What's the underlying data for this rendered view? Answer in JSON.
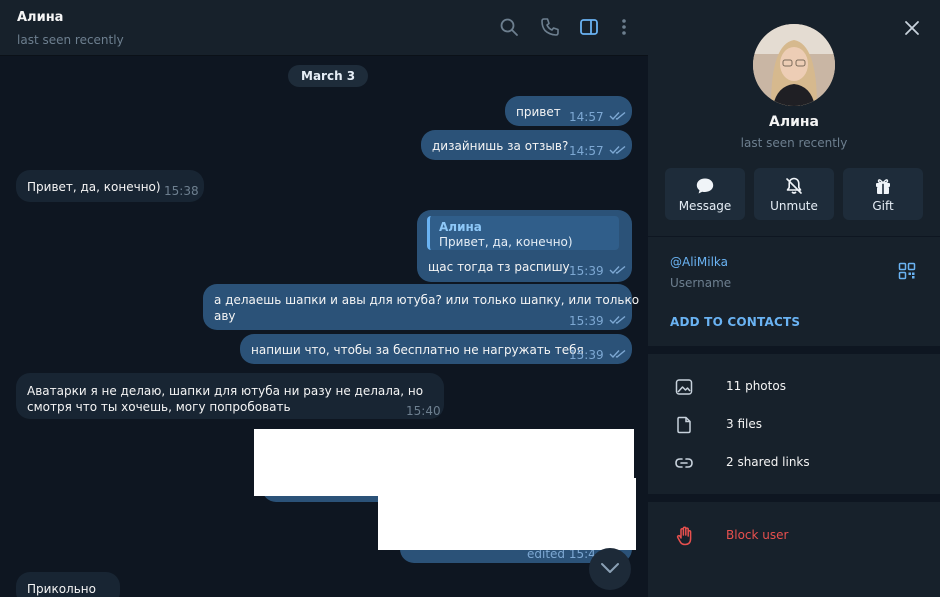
{
  "header": {
    "contact_name": "Алина",
    "status": "last seen recently",
    "icons": [
      "search-icon",
      "phone-icon",
      "sidebar-toggle-icon",
      "more-vertical-icon"
    ]
  },
  "chat": {
    "date_label": "March 3",
    "messages": [
      {
        "direction": "out",
        "text": "привет",
        "time": "14:57",
        "read": true
      },
      {
        "direction": "out",
        "text": "дизайнишь за отзыв?",
        "time": "14:57",
        "read": true
      },
      {
        "direction": "in",
        "text": "Привет, да, конечно)",
        "time": "15:38"
      },
      {
        "direction": "out",
        "reply_to": {
          "name": "Алина",
          "text": "Привет, да, конечно)"
        },
        "text": "щас тогда тз распишу",
        "time": "15:39",
        "read": true
      },
      {
        "direction": "out",
        "text_lines": [
          "а делаешь шапки и авы для ютуба? или только шапку, или только",
          "аву"
        ],
        "time": "15:39",
        "read": true
      },
      {
        "direction": "out",
        "text": "напиши что, чтобы за бесплатно не нагружать тебя",
        "time": "15:39",
        "read": true
      },
      {
        "direction": "in",
        "text_lines": [
          "Аватарки я не делаю, шапки для ютуба ни разу не делала, но",
          "смотря что ты хочешь, могу попробовать"
        ],
        "time": "15:40"
      },
      {
        "direction": "out",
        "time": "edited 15:4",
        "read": true
      },
      {
        "direction": "in",
        "text": "Прикольно"
      }
    ]
  },
  "profile": {
    "name": "Алина",
    "status": "last seen recently",
    "actions": [
      {
        "label": "Message",
        "icon": "chat-bubble-icon"
      },
      {
        "label": "Unmute",
        "icon": "bell-off-icon"
      },
      {
        "label": "Gift",
        "icon": "gift-icon"
      }
    ],
    "username": "@AliMilka",
    "username_label": "Username",
    "add_contacts": "ADD TO CONTACTS",
    "media": [
      {
        "label": "11 photos",
        "icon": "photo-icon"
      },
      {
        "label": "3 files",
        "icon": "file-icon"
      },
      {
        "label": "2 shared links",
        "icon": "link-icon"
      }
    ],
    "block_label": "Block user"
  },
  "colors": {
    "background": "#0e1621",
    "panel": "#17212b",
    "outgoing_bubble": "#2b5278",
    "incoming_bubble": "#182533",
    "accent": "#6ab3f3",
    "danger": "#e8504e"
  }
}
